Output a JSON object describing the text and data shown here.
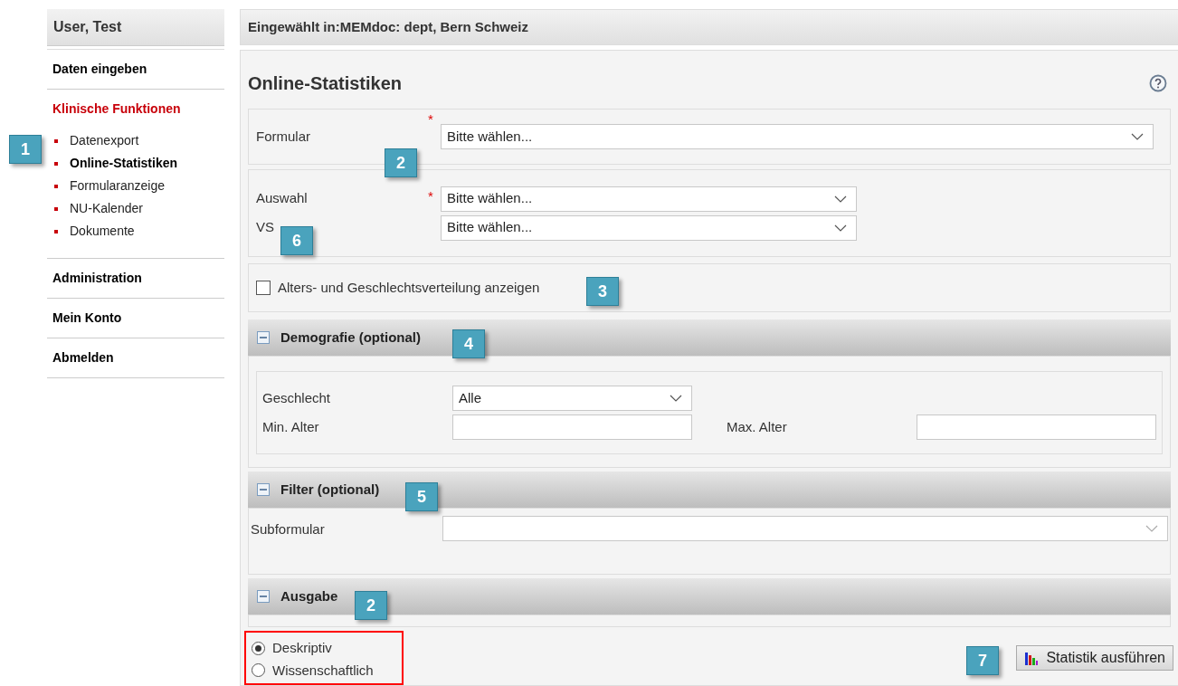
{
  "sidebar": {
    "user": "User, Test",
    "items": [
      {
        "label": "Daten eingeben",
        "active": false
      },
      {
        "label": "Klinische Funktionen",
        "active": true,
        "children": [
          {
            "label": "Datenexport",
            "selected": false
          },
          {
            "label": "Online-Statistiken",
            "selected": true
          },
          {
            "label": "Formularanzeige",
            "selected": false
          },
          {
            "label": "NU-Kalender",
            "selected": false
          },
          {
            "label": "Dokumente",
            "selected": false
          }
        ]
      },
      {
        "label": "Administration",
        "active": false
      },
      {
        "label": "Mein Konto",
        "active": false
      },
      {
        "label": "Abmelden",
        "active": false
      }
    ]
  },
  "header": "Eingewählt in:MEMdoc: dept, Bern Schweiz",
  "page_title": "Online-Statistiken",
  "formular": {
    "label": "Formular",
    "required_marker": "*",
    "value": "Bitte wählen..."
  },
  "auswahl": {
    "label": "Auswahl",
    "required_marker": "*",
    "value": "Bitte wählen..."
  },
  "vs": {
    "label": "VS",
    "value": "Bitte wählen..."
  },
  "age_gender": {
    "label": "Alters- und Geschlechtsverteilung anzeigen",
    "checked": false
  },
  "demografie": {
    "title": "Demografie (optional)",
    "expanded": true,
    "geschlecht_label": "Geschlecht",
    "geschlecht_value": "Alle",
    "min_label": "Min. Alter",
    "max_label": "Max. Alter"
  },
  "filter": {
    "title": "Filter (optional)",
    "expanded": true,
    "subformular_label": "Subformular"
  },
  "ausgabe": {
    "title": "Ausgabe",
    "expanded": true,
    "options": [
      {
        "label": "Deskriptiv",
        "selected": true
      },
      {
        "label": "Wissenschaftlich",
        "selected": false
      }
    ]
  },
  "run_button": "Statistik ausführen",
  "callouts": [
    "1",
    "2",
    "6",
    "3",
    "4",
    "5",
    "2",
    "7"
  ]
}
